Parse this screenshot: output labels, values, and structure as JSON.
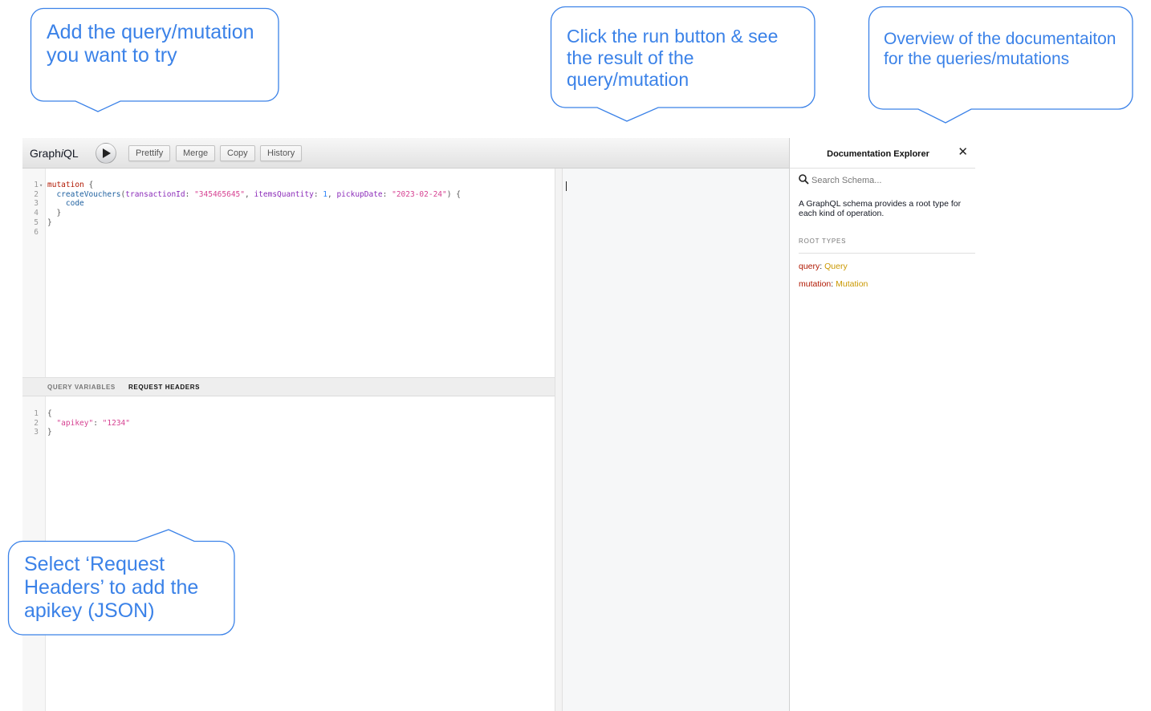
{
  "app": {
    "title_prefix": "Graph",
    "title_italic": "i",
    "title_suffix": "QL",
    "toolbar": {
      "prettify_label": "Prettify",
      "merge_label": "Merge",
      "copy_label": "Copy",
      "history_label": "History"
    },
    "query_editor": {
      "line_numbers": [
        "1",
        "2",
        "3",
        "4",
        "5",
        "6"
      ],
      "line1": {
        "keyword": "mutation",
        "rest": " {"
      },
      "line2": {
        "fn": "createVouchers",
        "open": "(",
        "arg1": "transactionId",
        "arg1_val": "\"345465645\"",
        "arg2": "itemsQuantity",
        "arg2_val": "1",
        "arg3": "pickupDate",
        "arg3_val": "\"2023-02-24\"",
        "close": ") {"
      },
      "line3": "code",
      "line4": "}",
      "line5": "}"
    },
    "variables_tabs": {
      "query_variables": "QUERY VARIABLES",
      "request_headers": "REQUEST HEADERS",
      "active": "request_headers"
    },
    "headers_editor": {
      "line_numbers": [
        "1",
        "2",
        "3"
      ],
      "open": "{",
      "key": "\"apikey\"",
      "value": "\"1234\"",
      "close": "}"
    },
    "docs": {
      "title": "Documentation Explorer",
      "close_glyph": "✕",
      "search_placeholder": "Search Schema...",
      "description": "A GraphQL schema provides a root type for each kind of operation.",
      "root_types_header": "ROOT TYPES",
      "root_types": [
        {
          "field": "query",
          "type": "Query"
        },
        {
          "field": "mutation",
          "type": "Mutation"
        }
      ]
    }
  },
  "callouts": {
    "query": "Add the query/mutation you want to try",
    "run": "Click the run button & see the result of the query/mutation",
    "docs": "Overview of the documentaiton for the queries/mutations",
    "headers": "Select ‘Request Headers’ to add the apikey (JSON)"
  },
  "colors": {
    "callout": "#3b82e8",
    "keyword": "#b11a04",
    "function": "#1f61a0",
    "argument": "#8b2bb9",
    "string": "#d64292",
    "number": "#2882f9",
    "type": "#ca9800"
  },
  "icons": {
    "run": "play-icon",
    "search": "search-icon",
    "close": "close-icon",
    "fold": "fold-arrow-icon"
  }
}
